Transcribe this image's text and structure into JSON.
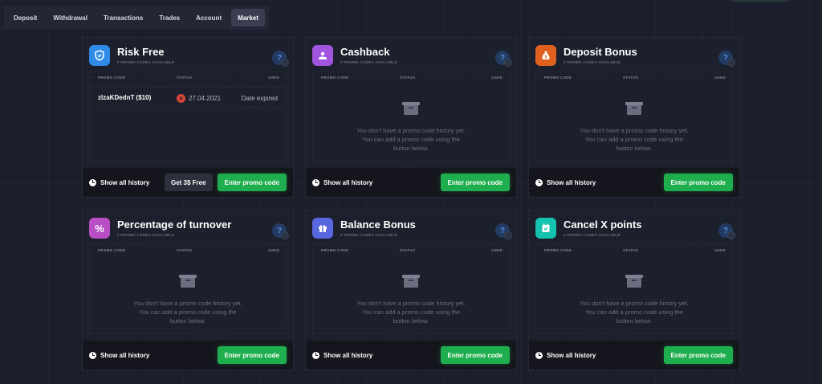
{
  "tabs": [
    {
      "label": "Deposit"
    },
    {
      "label": "Withdrawal"
    },
    {
      "label": "Transactions"
    },
    {
      "label": "Trades"
    },
    {
      "label": "Account"
    },
    {
      "label": "Market"
    }
  ],
  "active_tab": "Market",
  "table_headers": {
    "code": "PROMO CODE",
    "status": "STATUS",
    "used": "USED"
  },
  "empty_text": "You don't have a promo code history yet. You can add a promo code using the button below.",
  "show_history_label": "Show all history",
  "enter_code_label": "Enter promo code",
  "cards": [
    {
      "title": "Risk Free",
      "subtitle": "0 PROMO CODES AVAILABLE",
      "icon": "shield-icon",
      "color": "#2f8ae8",
      "row": {
        "code": "zlzaKDednT ($10)",
        "date": "27.04.2021",
        "status_text": "Date expired"
      },
      "extra_button": "Get 3$ Free"
    },
    {
      "title": "Cashback",
      "subtitle": "0 PROMO CODES AVAILABLE",
      "icon": "cashback-icon",
      "color": "#a154e0"
    },
    {
      "title": "Deposit Bonus",
      "subtitle": "0 PROMO CODES AVAILABLE",
      "icon": "money-bag-icon",
      "color": "#e0611f"
    },
    {
      "title": "Percentage of turnover",
      "subtitle": "0 PROMO CODES AVAILABLE",
      "icon": "percent-icon",
      "color": "#b94ec4"
    },
    {
      "title": "Balance Bonus",
      "subtitle": "0 PROMO CODES AVAILABLE",
      "icon": "gift-icon",
      "color": "#5867e0"
    },
    {
      "title": "Cancel X points",
      "subtitle": "0 PROMO CODES AVAILABLE",
      "icon": "cancel-points-icon",
      "color": "#14c2b0"
    }
  ]
}
